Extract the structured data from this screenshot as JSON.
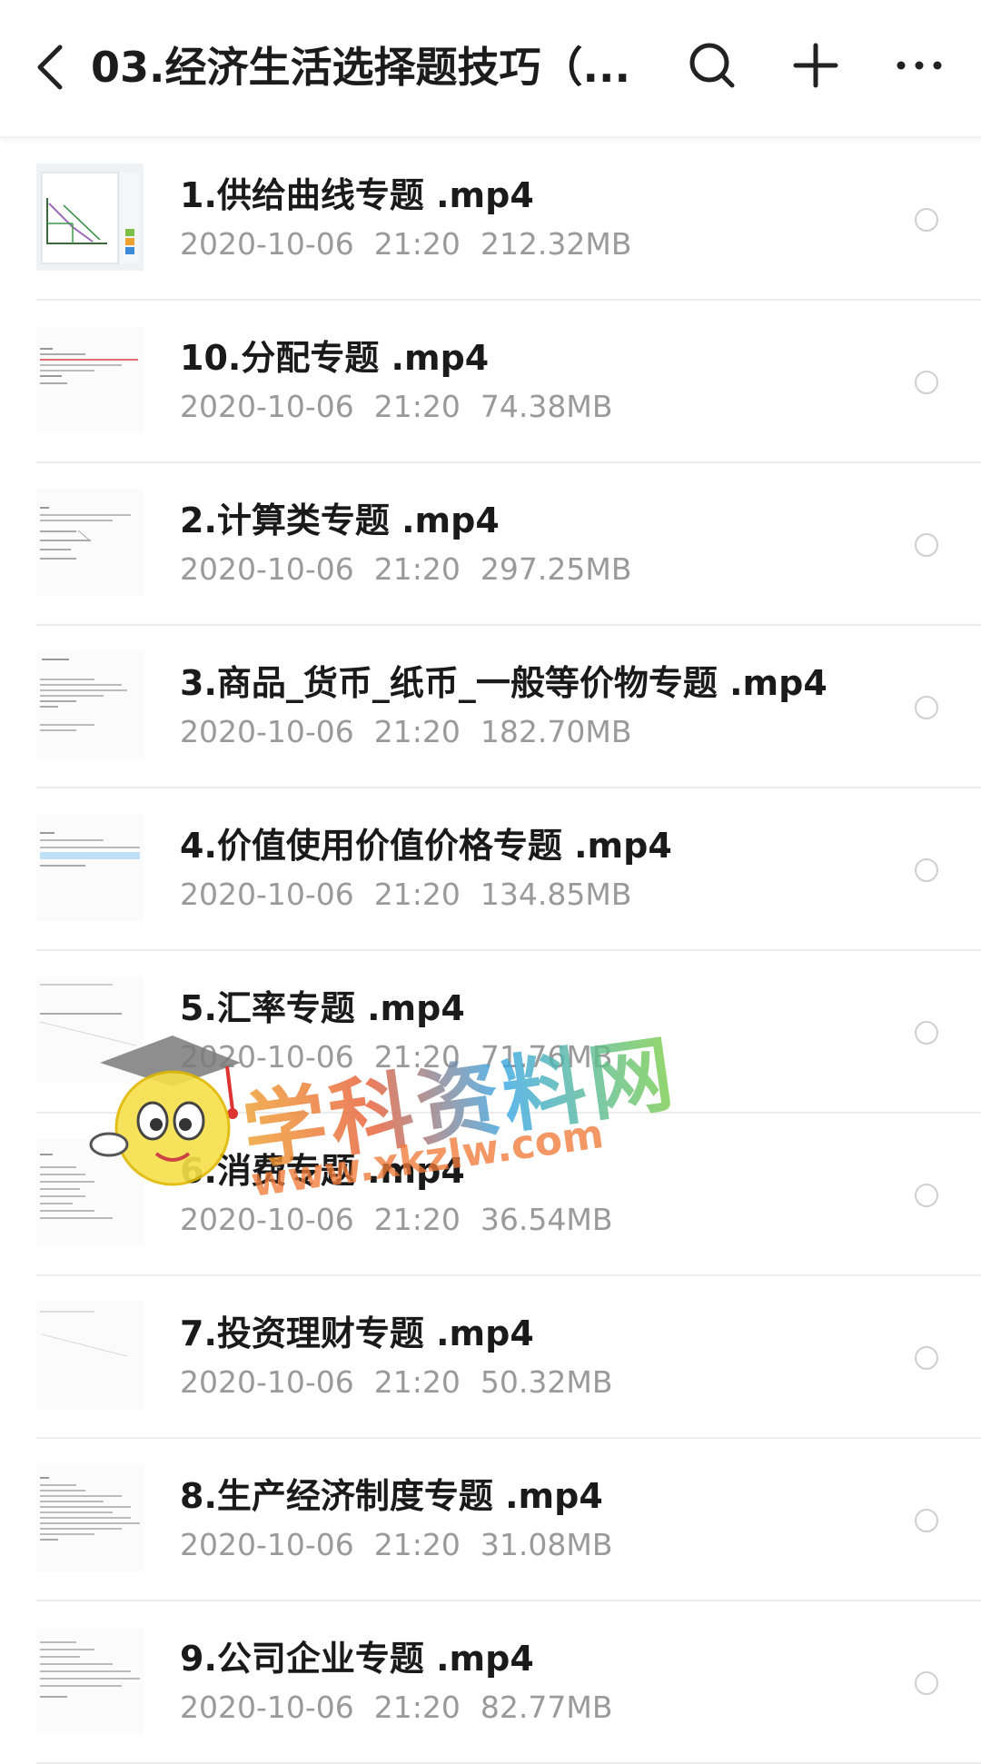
{
  "header": {
    "title": "03.经济生活选择题技巧（...",
    "back_icon": "back-arrow-icon",
    "search_icon": "search-icon",
    "add_icon": "plus-icon",
    "more_icon": "more-icon"
  },
  "files": [
    {
      "name": "1.供给曲线专题 .mp4",
      "date": "2020-10-06",
      "time": "21:20",
      "size": "212.32MB"
    },
    {
      "name": "10.分配专题 .mp4",
      "date": "2020-10-06",
      "time": "21:20",
      "size": "74.38MB"
    },
    {
      "name": "2.计算类专题 .mp4",
      "date": "2020-10-06",
      "time": "21:20",
      "size": "297.25MB"
    },
    {
      "name": "3.商品_货币_纸币_一般等价物专题 .mp4",
      "date": "2020-10-06",
      "time": "21:20",
      "size": "182.70MB"
    },
    {
      "name": "4.价值使用价值价格专题 .mp4",
      "date": "2020-10-06",
      "time": "21:20",
      "size": "134.85MB"
    },
    {
      "name": "5.汇率专题 .mp4",
      "date": "2020-10-06",
      "time": "21:20",
      "size": "71.76MB"
    },
    {
      "name": "6.消费专题 .mp4",
      "date": "2020-10-06",
      "time": "21:20",
      "size": "36.54MB"
    },
    {
      "name": "7.投资理财专题 .mp4",
      "date": "2020-10-06",
      "time": "21:20",
      "size": "50.32MB"
    },
    {
      "name": "8.生产经济制度专题 .mp4",
      "date": "2020-10-06",
      "time": "21:20",
      "size": "31.08MB"
    },
    {
      "name": "9.公司企业专题 .mp4",
      "date": "2020-10-06",
      "time": "21:20",
      "size": "82.77MB"
    }
  ],
  "watermark": {
    "text": "学科资料网",
    "url": "www.xkzlw.com"
  },
  "colors": {
    "title": "#1c1c1c",
    "meta": "#9a9a9a",
    "divider": "#ececec",
    "watermark_orange": "#f07a3a",
    "watermark_blue": "#3aa8e6",
    "watermark_green": "#7fcf4a"
  }
}
